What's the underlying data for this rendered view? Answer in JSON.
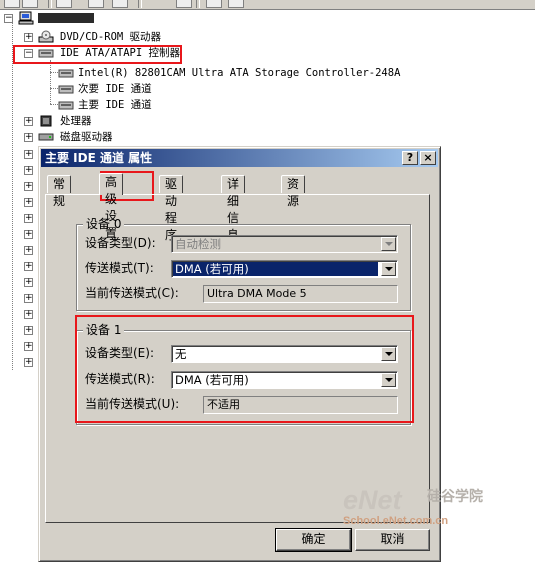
{
  "tree": {
    "computer_name": "",
    "dvd": "DVD/CD-ROM 驱动器",
    "ide": "IDE ATA/ATAPI 控制器",
    "ide_children": [
      "Intel(R) 82801CAM Ultra ATA Storage Controller-248A",
      "次要 IDE 通道",
      "主要 IDE 通道"
    ],
    "processor": "处理器",
    "disk": "磁盘驱动器"
  },
  "dialog": {
    "title": "主要 IDE 通道 属性",
    "help": "?",
    "close": "×",
    "tabs": [
      "常规",
      "高级设置",
      "驱动程序",
      "详细信息",
      "资源"
    ],
    "active_tab": "高级设置",
    "device0": {
      "title": "设备 0",
      "type_label": "设备类型(D):",
      "type_value": "自动检测",
      "mode_label": "传送模式(T):",
      "mode_value": "DMA (若可用)",
      "current_label": "当前传送模式(C):",
      "current_value": "Ultra DMA Mode 5"
    },
    "device1": {
      "title": "设备 1",
      "type_label": "设备类型(E):",
      "type_value": "无",
      "mode_label": "传送模式(R):",
      "mode_value": "DMA (若可用)",
      "current_label": "当前传送模式(U):",
      "current_value": "不适用"
    },
    "ok": "确定",
    "cancel": "取消"
  },
  "watermark": {
    "brand": "eNet",
    "cn": "硅谷学院",
    "url": "School.eNet.com.cn"
  },
  "colors": {
    "highlight_red": "#e8171b",
    "title_blue": "#0a246a",
    "face": "#d4d0c8"
  }
}
